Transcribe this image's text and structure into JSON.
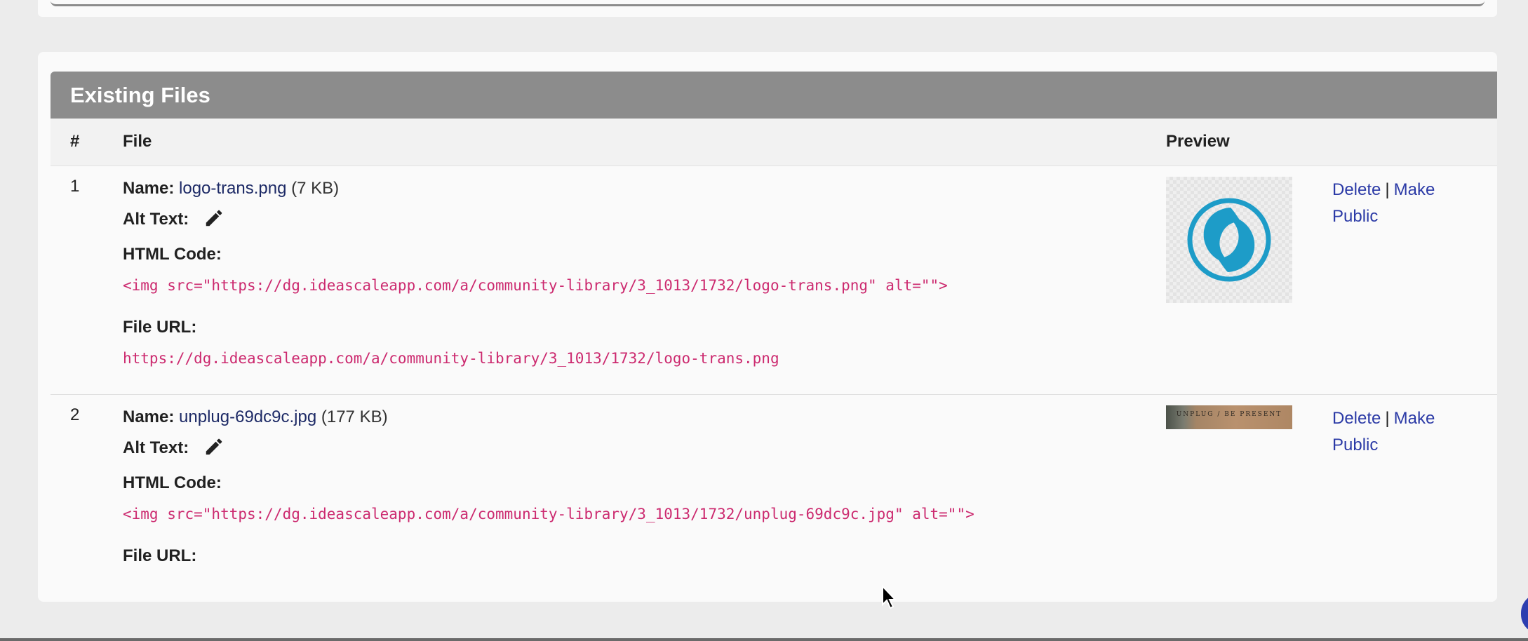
{
  "section": {
    "title": "Existing Files"
  },
  "table": {
    "columns": {
      "index": "#",
      "file": "File",
      "preview": "Preview"
    }
  },
  "labels": {
    "name": "Name:",
    "alt_text": "Alt Text:",
    "html_code": "HTML Code:",
    "file_url": "File URL:",
    "delete": "Delete",
    "separator": "|",
    "make_public": "Make Public"
  },
  "files": [
    {
      "index": "1",
      "name": "logo-trans.png",
      "size": "(7 KB)",
      "html_code": "<img src=\"https://dg.ideascaleapp.com/a/community-library/3_1013/1732/logo-trans.png\" alt=\"\">",
      "url": "https://dg.ideascaleapp.com/a/community-library/3_1013/1732/logo-trans.png",
      "preview_icon": "swirl-logo-icon"
    },
    {
      "index": "2",
      "name": "unplug-69dc9c.jpg",
      "size": "(177 KB)",
      "html_code": "<img src=\"https://dg.ideascaleapp.com/a/community-library/3_1013/1732/unplug-69dc9c.jpg\" alt=\"\">",
      "preview_caption": "UNPLUG / BE PRESENT"
    }
  ],
  "colors": {
    "header_bg": "#8c8c8c",
    "link": "#2b3aa6",
    "code": "#cc2a6f",
    "logo_blue": "#1d9cc8"
  }
}
